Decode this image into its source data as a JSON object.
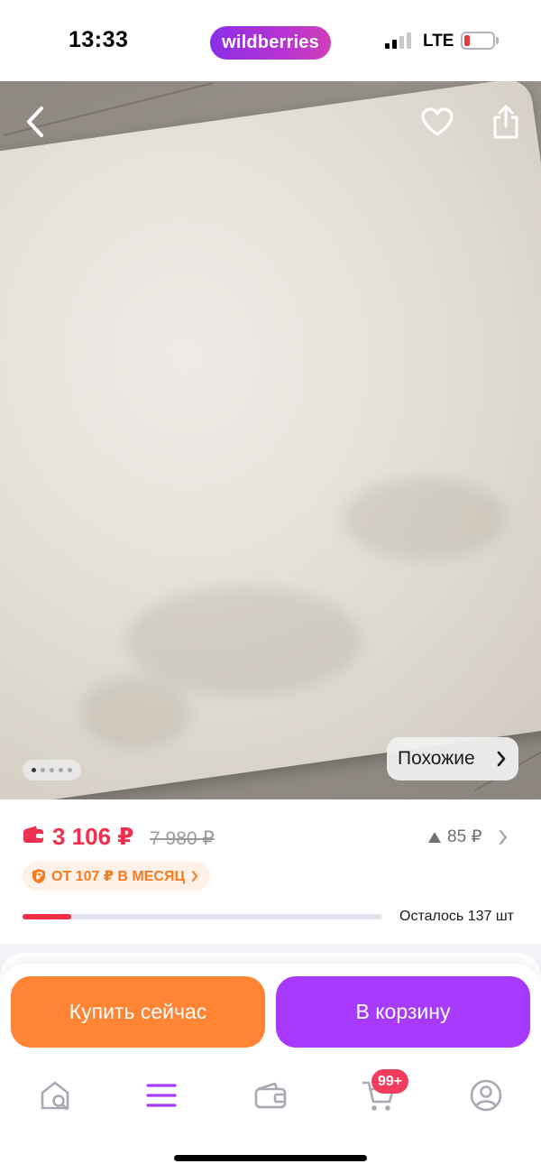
{
  "status_bar": {
    "time": "13:33",
    "brand": "wildberries",
    "network": "LTE",
    "battery_level": 0.15,
    "battery_color": "#e83b3b"
  },
  "gallery": {
    "back_icon": "chevron-left-icon",
    "favorite_icon": "heart-icon",
    "share_icon": "share-icon",
    "page_dots_count": 5,
    "active_dot": 0,
    "similar_label": "Похожие"
  },
  "price": {
    "current": "3 106 ₽",
    "old": "7 980 ₽",
    "delta": "85 ₽",
    "installment": "ОТ 107 ₽ В МЕСЯЦ",
    "stock_text": "Осталось 137 шт",
    "stock_fraction": 0.135,
    "accent_color": "#f0304e"
  },
  "actions": {
    "buy_now": "Купить сейчас",
    "add_to_cart": "В корзину",
    "buy_color": "#ff8534",
    "cart_color": "#a73afd"
  },
  "tabbar": {
    "items": [
      {
        "icon": "home-search-icon"
      },
      {
        "icon": "catalog-menu-icon"
      },
      {
        "icon": "wallet-icon"
      },
      {
        "icon": "cart-icon"
      },
      {
        "icon": "profile-icon"
      }
    ],
    "cart_badge": "99+",
    "active_color": "#a73afd"
  }
}
